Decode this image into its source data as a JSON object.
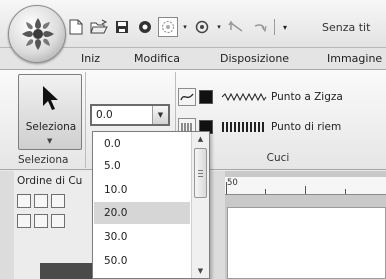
{
  "titlebar": {
    "document_title": "Senza tit",
    "qat_icons": [
      "new-document-icon",
      "open-folder-icon",
      "save-icon",
      "record-icon",
      "stitch-wheel-icon",
      "stitch-color-icon",
      "undo-icon",
      "redo-icon",
      "customize-qat-icon"
    ]
  },
  "tabs": [
    "Iniz",
    "Modifica",
    "Disposizione",
    "Immagine"
  ],
  "ribbon": {
    "select_button_label": "Seleziona",
    "select_group_label": "Seleziona",
    "value_combo": {
      "value": "0.0"
    },
    "cuci_group_label": "Cuci",
    "stitch_rows": [
      {
        "label": "Punto a Zigza",
        "type_icon": "line-sew-icon",
        "pattern_icon": "zigzag-pattern-icon"
      },
      {
        "label": "Punto di riem",
        "type_icon": "region-sew-icon",
        "pattern_icon": "fill-pattern-icon"
      }
    ]
  },
  "panel": {
    "title": "Ordine di Cu"
  },
  "canvas": {
    "ruler_label": "50"
  },
  "dropdown": {
    "options": [
      "0.0",
      "5.0",
      "10.0",
      "20.0",
      "30.0",
      "50.0"
    ],
    "selected": "20.0"
  },
  "colors": {
    "selected_bg": "#d6d6d6",
    "ribbon_bg": "#eeeeee",
    "frame": "#7d7d7d"
  }
}
